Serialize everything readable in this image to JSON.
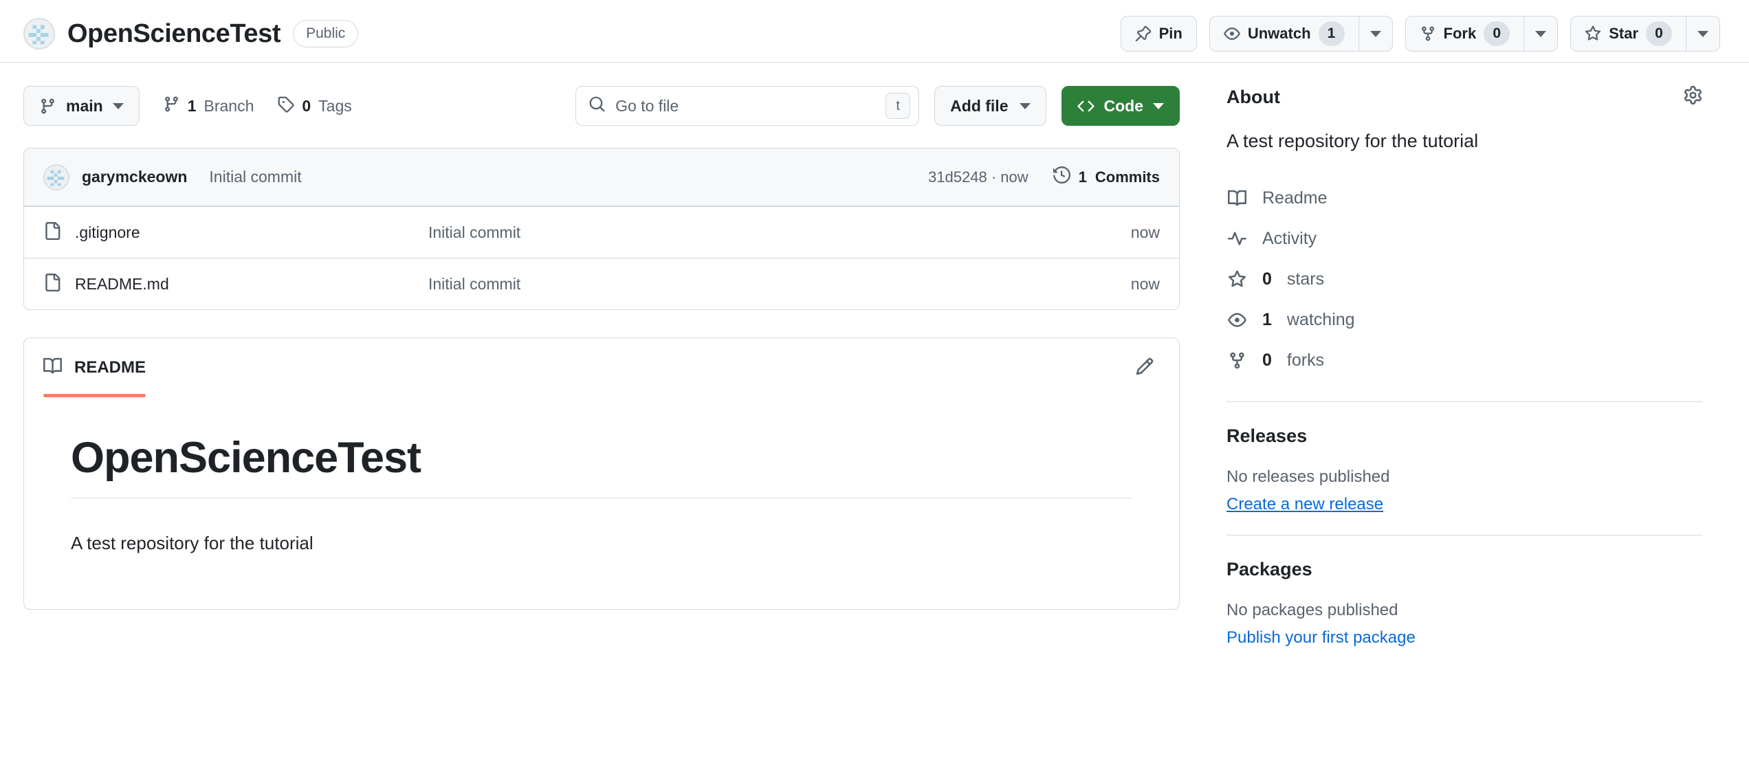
{
  "header": {
    "repo_name": "OpenScienceTest",
    "visibility": "Public",
    "avatar_icon": "repo-identicon-avatar",
    "actions": {
      "pin": {
        "label": "Pin",
        "icon": "pin-icon"
      },
      "watch": {
        "label": "Unwatch",
        "count": "1",
        "icon": "eye-icon"
      },
      "fork": {
        "label": "Fork",
        "count": "0",
        "icon": "repo-forked-icon"
      },
      "star": {
        "label": "Star",
        "count": "0",
        "icon": "star-icon"
      }
    }
  },
  "toolbar": {
    "branch": {
      "label": "main",
      "icon": "git-branch-icon"
    },
    "branch_count": {
      "value": "1",
      "label": "Branch",
      "icon": "git-branch-icon"
    },
    "tag_count": {
      "value": "0",
      "label": "Tags",
      "icon": "tag-icon"
    },
    "search": {
      "placeholder": "Go to file",
      "shortcut": "t",
      "icon": "search-icon"
    },
    "add_file": {
      "label": "Add file"
    },
    "code": {
      "label": "Code",
      "icon": "code-icon",
      "color": "#2c8039"
    }
  },
  "commit_bar": {
    "author": "garymckeown",
    "message": "Initial commit",
    "hash_and_time": "31d5248 · now",
    "commits_count": "1",
    "commits_label": "Commits",
    "history_icon": "history-icon"
  },
  "files": [
    {
      "name": ".gitignore",
      "icon": "file-icon",
      "commit": "Initial commit",
      "time": "now"
    },
    {
      "name": "README.md",
      "icon": "file-icon",
      "commit": "Initial commit",
      "time": "now"
    }
  ],
  "readme": {
    "tab_label": "README",
    "tab_icon": "book-icon",
    "edit_icon": "pencil-icon",
    "accent_color": "#f08262",
    "heading": "OpenScienceTest",
    "paragraph": "A test repository for the tutorial"
  },
  "sidebar": {
    "about": {
      "title": "About",
      "gear_icon": "gear-icon",
      "description": "A test repository for the tutorial",
      "links": [
        {
          "icon": "book-icon",
          "bold": "",
          "label": "Readme"
        },
        {
          "icon": "pulse-icon",
          "bold": "",
          "label": "Activity"
        },
        {
          "icon": "star-icon",
          "bold": "0",
          "label": "stars"
        },
        {
          "icon": "eye-icon",
          "bold": "1",
          "label": "watching"
        },
        {
          "icon": "repo-forked-icon",
          "bold": "0",
          "label": "forks"
        }
      ]
    },
    "releases": {
      "title": "Releases",
      "empty_text": "No releases published",
      "action_label": "Create a new release",
      "link_color": "#0969da"
    },
    "packages": {
      "title": "Packages",
      "empty_text": "No packages published",
      "action_label": "Publish your first package",
      "link_color": "#0969da"
    }
  }
}
